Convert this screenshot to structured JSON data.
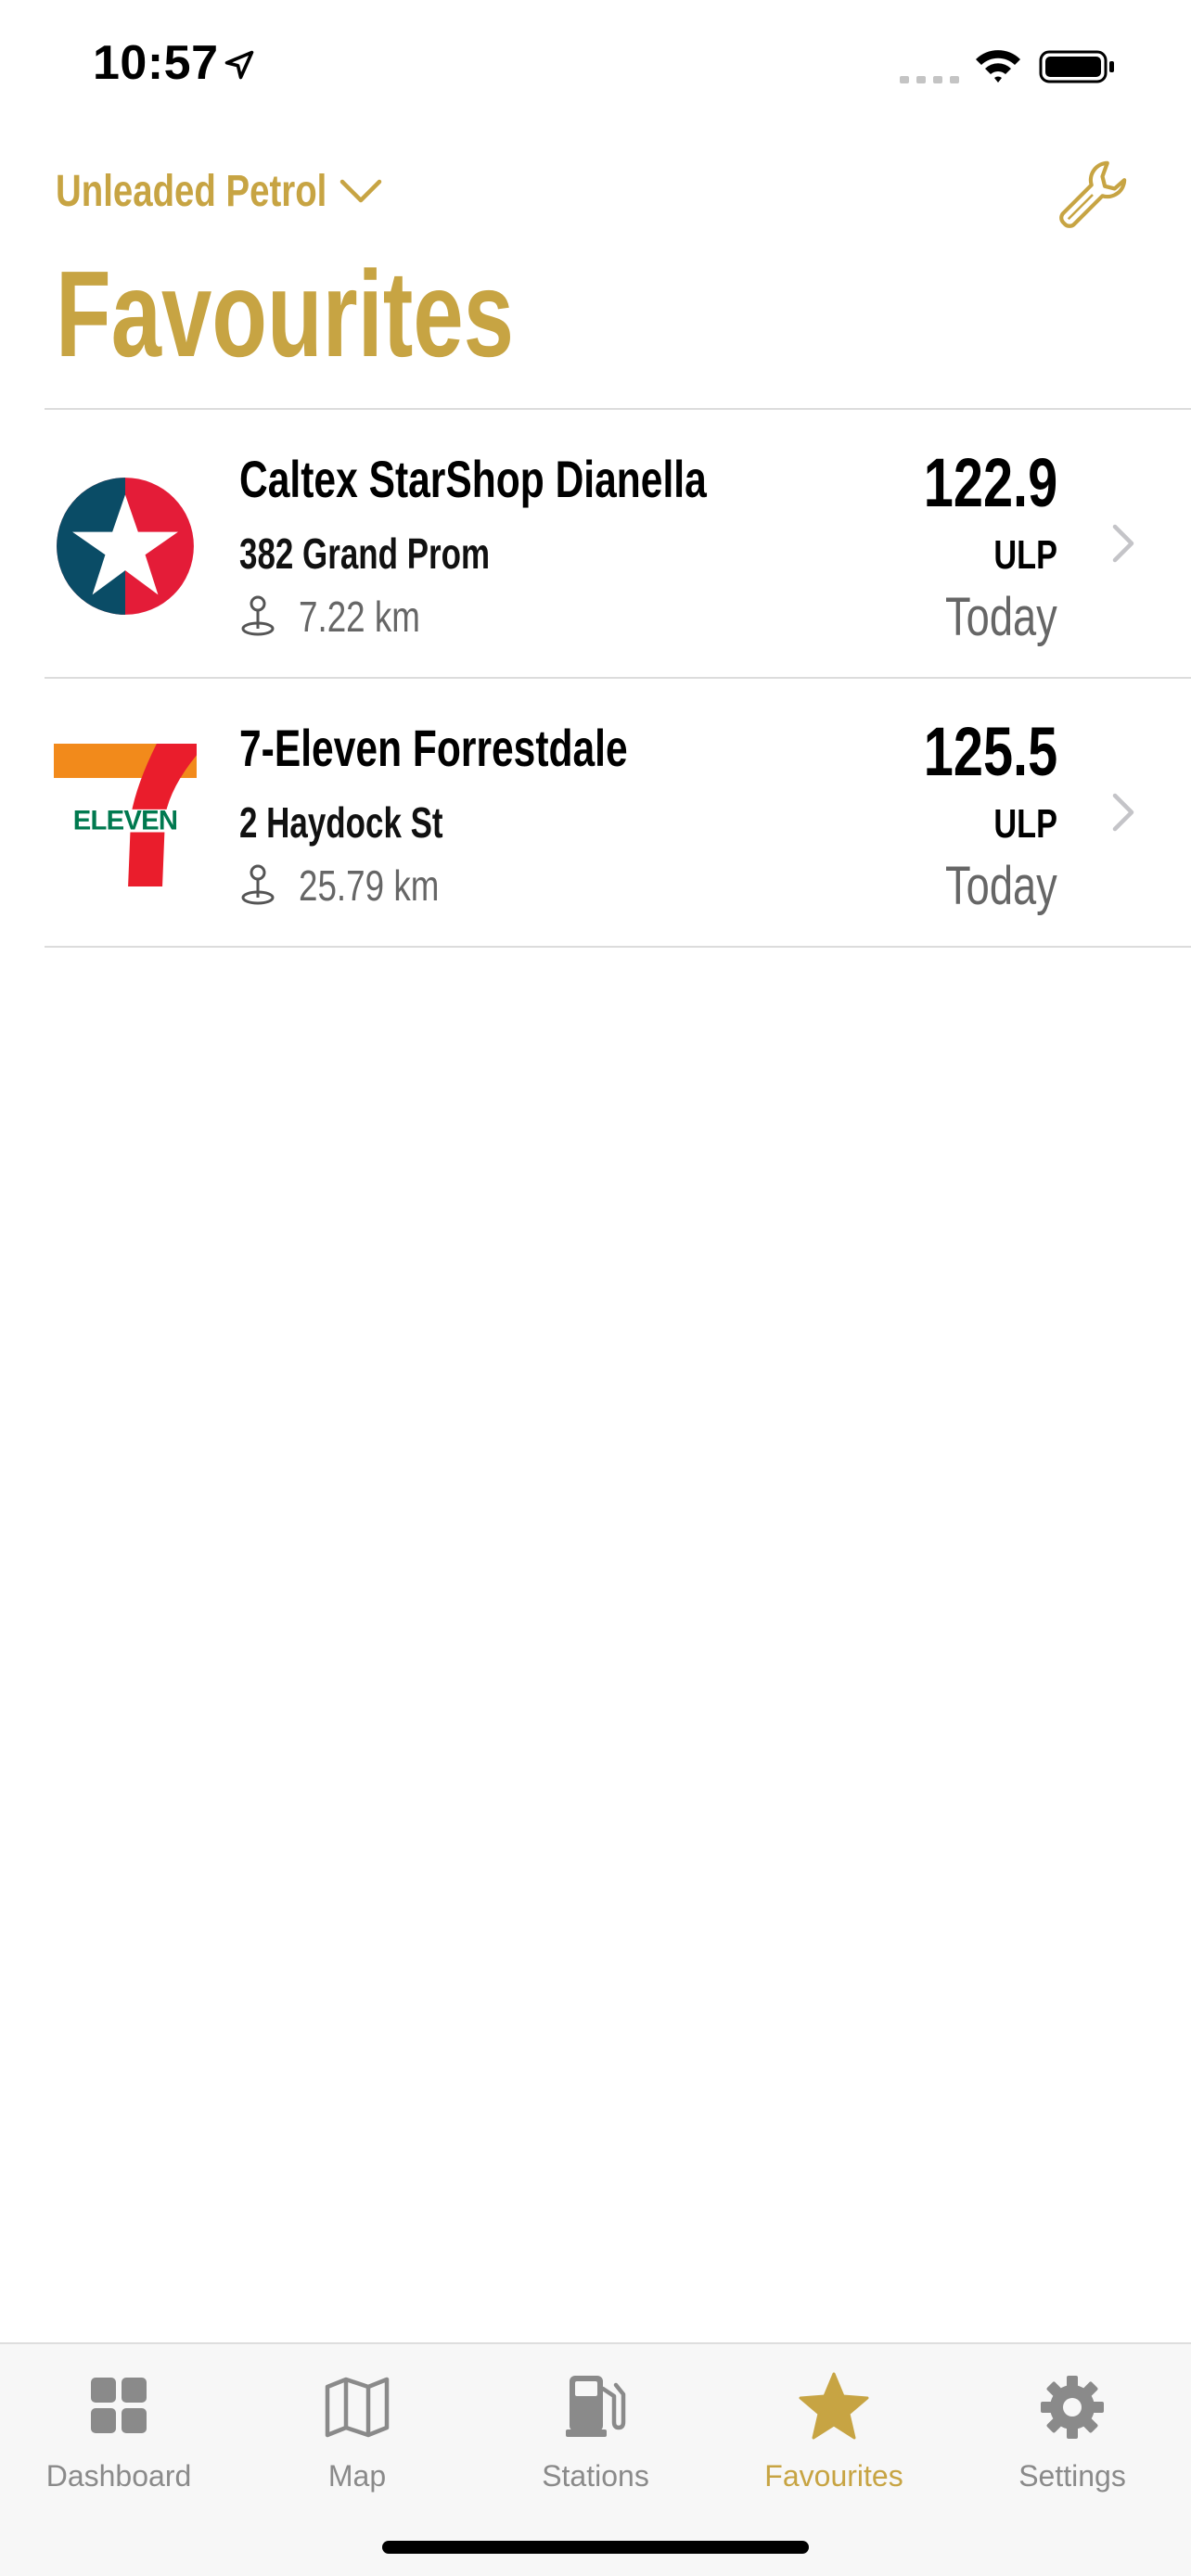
{
  "status_bar": {
    "time": "10:57"
  },
  "header": {
    "fuel_type": "Unleaded Petrol",
    "title": "Favourites"
  },
  "stations": [
    {
      "name": "Caltex StarShop Dianella",
      "address": "382 Grand Prom",
      "distance": "7.22 km",
      "price": "122.9",
      "fuel_code": "ULP",
      "date": "Today",
      "logo": "caltex-logo"
    },
    {
      "name": "7-Eleven Forrestdale",
      "address": "2 Haydock St",
      "distance": "25.79 km",
      "price": "125.5",
      "fuel_code": "ULP",
      "date": "Today",
      "logo": "7eleven-logo"
    }
  ],
  "tabs": [
    {
      "label": "Dashboard",
      "icon": "grid-icon",
      "active": false
    },
    {
      "label": "Map",
      "icon": "map-icon",
      "active": false
    },
    {
      "label": "Stations",
      "icon": "fuel-pump-icon",
      "active": false
    },
    {
      "label": "Favourites",
      "icon": "star-icon",
      "active": true
    },
    {
      "label": "Settings",
      "icon": "gear-icon",
      "active": false
    }
  ],
  "colors": {
    "accent": "#c7a443",
    "inactive_tab": "#8a8a8a",
    "secondary_text": "#666666"
  }
}
